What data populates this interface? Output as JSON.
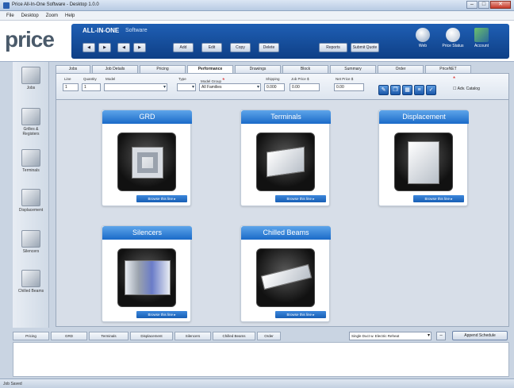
{
  "window": {
    "title": "Price All-In-One Software - Desktop 1.0.0"
  },
  "menu": [
    "File",
    "Desktop",
    "Zoom",
    "Help"
  ],
  "brand": {
    "logo": "price",
    "product": "ALL-IN-ONE",
    "product_sub": "Software",
    "toolbar": [
      "◀",
      "▶",
      "◀",
      "▶",
      "Add",
      "Edit",
      "Copy",
      "Delete",
      "Reports",
      "Submit Quote"
    ],
    "right_icons": [
      {
        "icon": "web-icon",
        "label": "Web"
      },
      {
        "icon": "price-status-icon",
        "label": "Price Status"
      },
      {
        "icon": "account-icon",
        "label": "Account"
      }
    ]
  },
  "sidebar": [
    {
      "label": "Jobs",
      "icon": "jobs-icon"
    },
    {
      "label": "Grilles & Registers",
      "icon": "grilles-icon"
    },
    {
      "label": "Terminals",
      "icon": "terminals-icon"
    },
    {
      "label": "Displacement",
      "icon": "displacement-icon"
    },
    {
      "label": "Silencers",
      "icon": "silencers-icon"
    },
    {
      "label": "Chilled Beams",
      "icon": "chilled-beams-icon"
    }
  ],
  "tabs": [
    "Jobs",
    "Job Details",
    "Pricing",
    "Performance",
    "Drawings",
    "Block",
    "Summary",
    "Order",
    "PriceNET"
  ],
  "active_tab": "Performance",
  "filters": {
    "line_label": "Line",
    "line_value": "1",
    "qty_label": "Quantity",
    "qty_value": "1",
    "model_label": "Model",
    "type_label": "Type",
    "model_group_label": "Model Group",
    "model_group_value": "All Families",
    "shipping_label": "Shipping",
    "shipping_value": "0.000",
    "job_price_label": "Job Price $",
    "job_price_value": "0.00",
    "net_price_label": "Net Price $",
    "net_price_value": "0.00",
    "adv_label": "Adv. Catalog"
  },
  "cards": [
    {
      "title": "GRD",
      "link": "Browse this line ▸",
      "icon": "grd-diffuser-icon"
    },
    {
      "title": "Terminals",
      "link": "Browse this line ▸",
      "icon": "terminal-unit-icon"
    },
    {
      "title": "Displacement",
      "link": "Browse this line ▸",
      "icon": "displacement-unit-icon"
    },
    {
      "title": "Silencers",
      "link": "Browse this line ▸",
      "icon": "silencer-icon"
    },
    {
      "title": "Chilled Beams",
      "link": "Browse this line ▸",
      "icon": "chilled-beam-icon"
    }
  ],
  "bottom_tabs": [
    "Pricing",
    "GRD",
    "Terminals",
    "Displacement",
    "Silencers",
    "Chilled Beams",
    "Order"
  ],
  "bottom_select": "Single Duct w. Electric Reheat",
  "bottom_button": "Append Schedule",
  "status": "Job Saved",
  "colors": {
    "accent": "#1a6ac8",
    "panel": "#0e3f86"
  }
}
